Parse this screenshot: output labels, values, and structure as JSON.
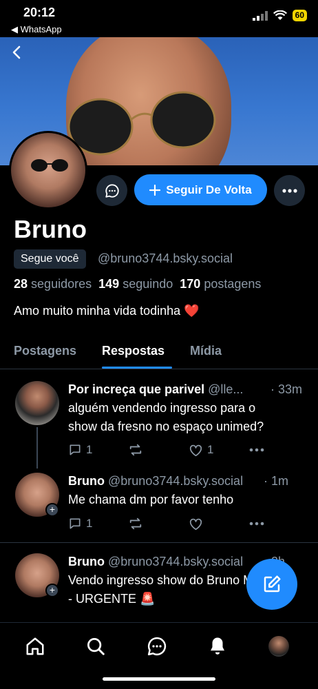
{
  "status_bar": {
    "time": "20:12",
    "back_app": "◀ WhatsApp",
    "battery": "60"
  },
  "profile": {
    "name": "Bruno",
    "follows_you": "Segue você",
    "handle": "@bruno3744.bsky.social",
    "followers_count": "28",
    "followers_label": "seguidores",
    "following_count": "149",
    "following_label": "seguindo",
    "posts_count": "170",
    "posts_label": "postagens",
    "bio": "Amo muito minha vida todinha ❤️",
    "follow_back_label": "Seguir De Volta"
  },
  "tabs": [
    {
      "label": "Postagens",
      "active": false
    },
    {
      "label": "Respostas",
      "active": true
    },
    {
      "label": "Mídia",
      "active": false
    }
  ],
  "posts": [
    {
      "author": "Por increça que parivel",
      "handle": "@lle...",
      "time": "· 33m",
      "text_line1": "alguém vendendo ingresso para o",
      "text_line2": "show da fresno no espaço unimed?",
      "replies": "1",
      "likes": "1"
    },
    {
      "author": "Bruno",
      "handle": "@bruno3744.bsky.social",
      "time": "· 1m",
      "text_line1": "Me chama dm por favor tenho",
      "replies": "1"
    },
    {
      "author": "Bruno",
      "handle": "@bruno3744.bsky.social",
      "time": "· 2h",
      "text_line1": "Vendo ingresso show do Bruno Mars",
      "text_line2": "- URGENTE 🚨"
    }
  ],
  "colors": {
    "accent": "#208bfe",
    "muted": "#8d99a6",
    "surface": "#1e2936"
  }
}
